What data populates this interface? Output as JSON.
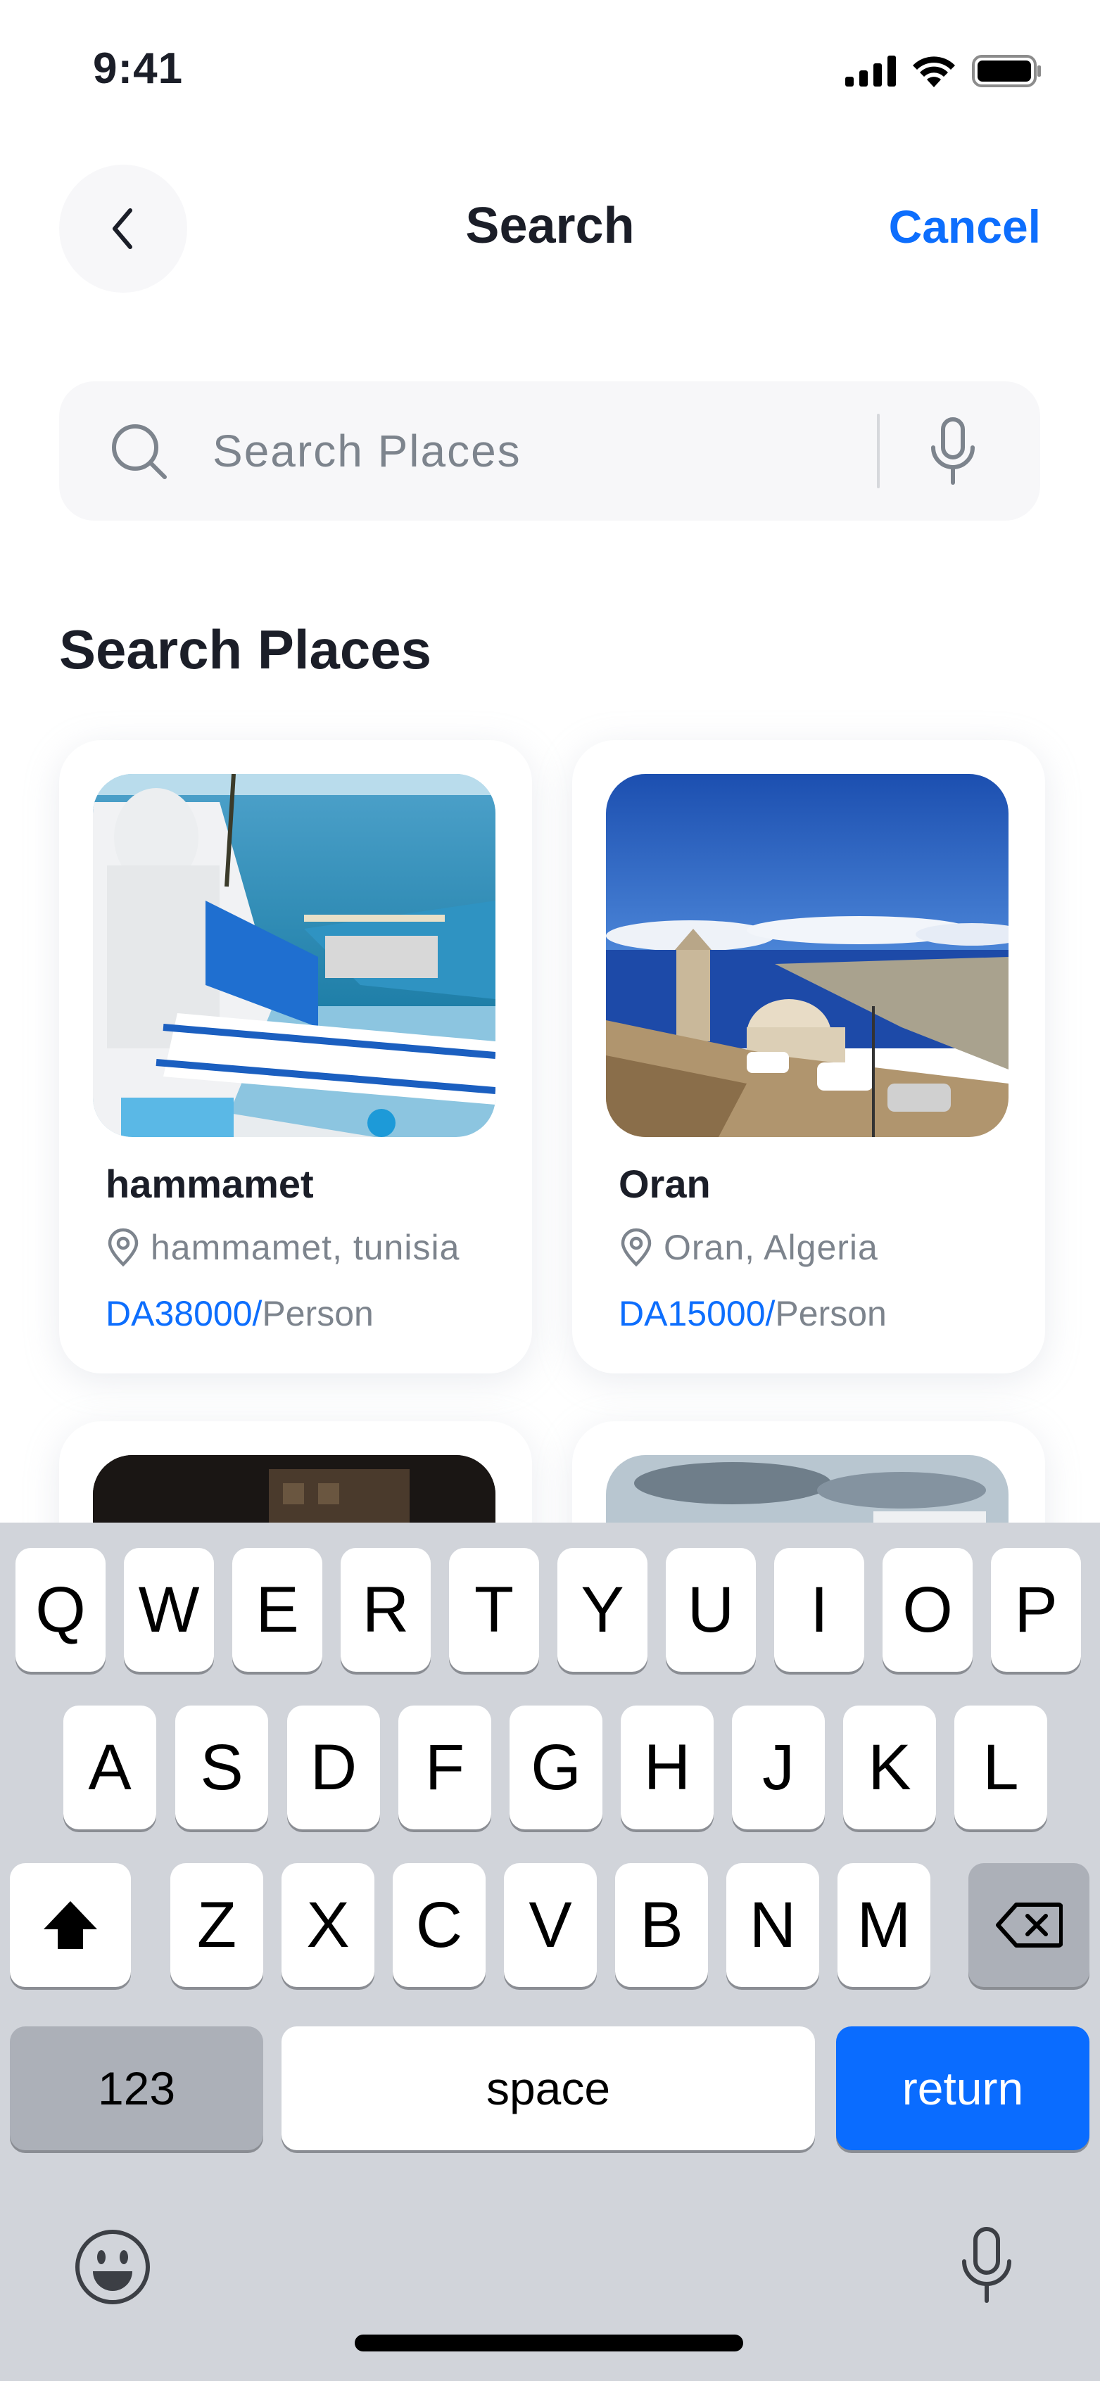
{
  "status_bar": {
    "time": "9:41"
  },
  "header": {
    "title": "Search",
    "cancel_label": "Cancel"
  },
  "search": {
    "placeholder": "Search Places",
    "value": ""
  },
  "section_title": "Search Places",
  "places": [
    {
      "name": "hammamet",
      "location": "hammamet, tunisia",
      "price": "DA38000/",
      "unit": "Person"
    },
    {
      "name": "Oran",
      "location": "Oran, Algeria",
      "price": "DA15000/",
      "unit": "Person"
    }
  ],
  "keyboard": {
    "row1": [
      "Q",
      "W",
      "E",
      "R",
      "T",
      "Y",
      "U",
      "I",
      "O",
      "P"
    ],
    "row2": [
      "A",
      "S",
      "D",
      "F",
      "G",
      "H",
      "J",
      "K",
      "L"
    ],
    "row3": [
      "Z",
      "X",
      "C",
      "V",
      "B",
      "N",
      "M"
    ],
    "numbers_label": "123",
    "space_label": "space",
    "return_label": "return"
  },
  "icons": {
    "back": "chevron-left-icon",
    "search": "search-icon",
    "mic": "microphone-icon",
    "location": "location-pin-icon",
    "shift": "shift-icon",
    "delete": "backspace-icon",
    "emoji": "emoji-icon",
    "dictation": "microphone-icon"
  },
  "colors": {
    "accent": "#0d6efd",
    "text": "#1b1e28",
    "muted": "#7d848d"
  }
}
